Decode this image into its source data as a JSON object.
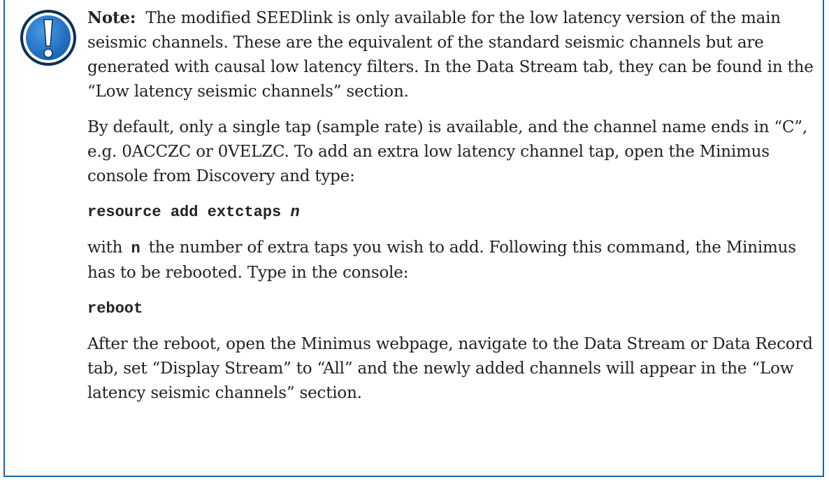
{
  "note": {
    "colors": {
      "border": "#1a63b0",
      "icon_fill": "#1a6fc4",
      "icon_ring": "#0c2f55",
      "text": "#222222"
    },
    "icon": "exclamation-circle-icon",
    "label": "Note:",
    "p1": "The modified SEEDlink is only available for the low latency version of the main seismic channels. These are the equivalent of the standard seismic channels but are generated with causal low latency filters. In the Data Stream tab, they can be found in the “Low latency seismic channels” section.",
    "p2": "By default, only a single tap (sample rate) is available, and the channel name ends in “C”, e.g. 0ACCZC or 0VELZC. To add an extra low latency channel tap, open the Minimus console from Discovery and type:",
    "cmd1": "resource add extctaps",
    "cmd1_arg": "n",
    "p3_before": "with",
    "p3_code": "n",
    "p3_after": "the number of extra taps you wish to add. Following this command, the Minimus has to be rebooted. Type in the console:",
    "cmd2": "reboot",
    "p4": "After the reboot, open the Minimus webpage, navigate to the Data Stream or Data Record tab, set “Display Stream” to “All” and the newly added channels will appear in the “Low latency seismic channels” section."
  }
}
